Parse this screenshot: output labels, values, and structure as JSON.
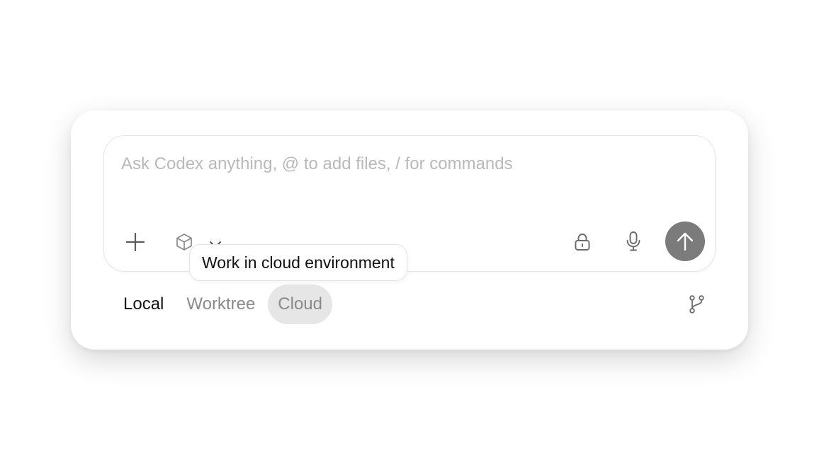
{
  "composer": {
    "placeholder": "Ask Codex anything, @ to add files, / for commands",
    "value": ""
  },
  "toolbar": {
    "add_icon": "plus-icon",
    "environment_icon": "cube-icon",
    "environment_menu_icon": "chevron-down-icon",
    "permissions_icon": "lock-icon",
    "voice_icon": "microphone-icon",
    "send_icon": "arrow-up-icon"
  },
  "tooltip": {
    "text": "Work in cloud environment"
  },
  "modes": {
    "selected": "Local",
    "items": [
      {
        "label": "Local"
      },
      {
        "label": "Worktree"
      },
      {
        "label": "Cloud"
      }
    ]
  },
  "branch": {
    "icon": "git-branch-icon"
  },
  "colors": {
    "send_button": "#7b7b7b",
    "hover_tab_background": "#e6e6e6",
    "placeholder": "#b9b9b9"
  }
}
